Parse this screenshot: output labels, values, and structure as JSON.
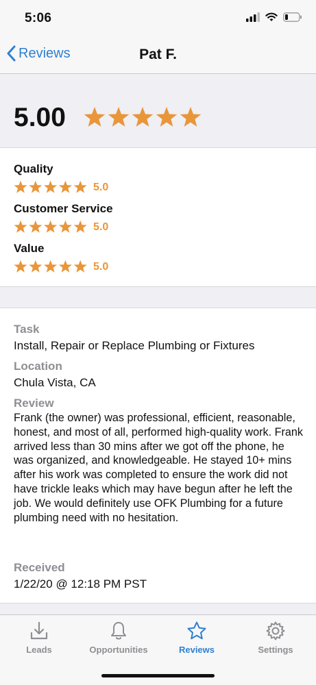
{
  "status": {
    "time": "5:06"
  },
  "nav": {
    "back_label": "Reviews",
    "title": "Pat F."
  },
  "overall": {
    "score_text": "5.00",
    "rating": 5
  },
  "categories": [
    {
      "label": "Quality",
      "value_text": "5.0",
      "rating": 5
    },
    {
      "label": "Customer Service",
      "value_text": "5.0",
      "rating": 5
    },
    {
      "label": "Value",
      "value_text": "5.0",
      "rating": 5
    }
  ],
  "details": {
    "task_label": "Task",
    "task_value": "Install, Repair or Replace Plumbing or Fixtures",
    "location_label": "Location",
    "location_value": "Chula Vista, CA",
    "review_label": "Review",
    "review_text": "Frank (the owner) was professional, efficient, reasonable, honest, and most of all, performed high-quality work. Frank arrived less than 30 mins after we got off the phone, he was organized, and knowledgeable. He stayed 10+ mins after his work was completed to ensure the work did not have trickle leaks which may have begun after he left the job. We would definitely use OFK Plumbing for a future plumbing need with no hesitation.",
    "received_label": "Received",
    "received_value": "1/22/20 @ 12:18 PM PST"
  },
  "tabs": [
    {
      "label": "Leads",
      "icon": "download-tray-icon",
      "active": false
    },
    {
      "label": "Opportunities",
      "icon": "bell-icon",
      "active": false
    },
    {
      "label": "Reviews",
      "icon": "star-icon",
      "active": true
    },
    {
      "label": "Settings",
      "icon": "gear-icon",
      "active": false
    }
  ],
  "colors": {
    "accent": "#2f7fd1",
    "star": "#e9963a",
    "muted": "#8e8e93"
  }
}
